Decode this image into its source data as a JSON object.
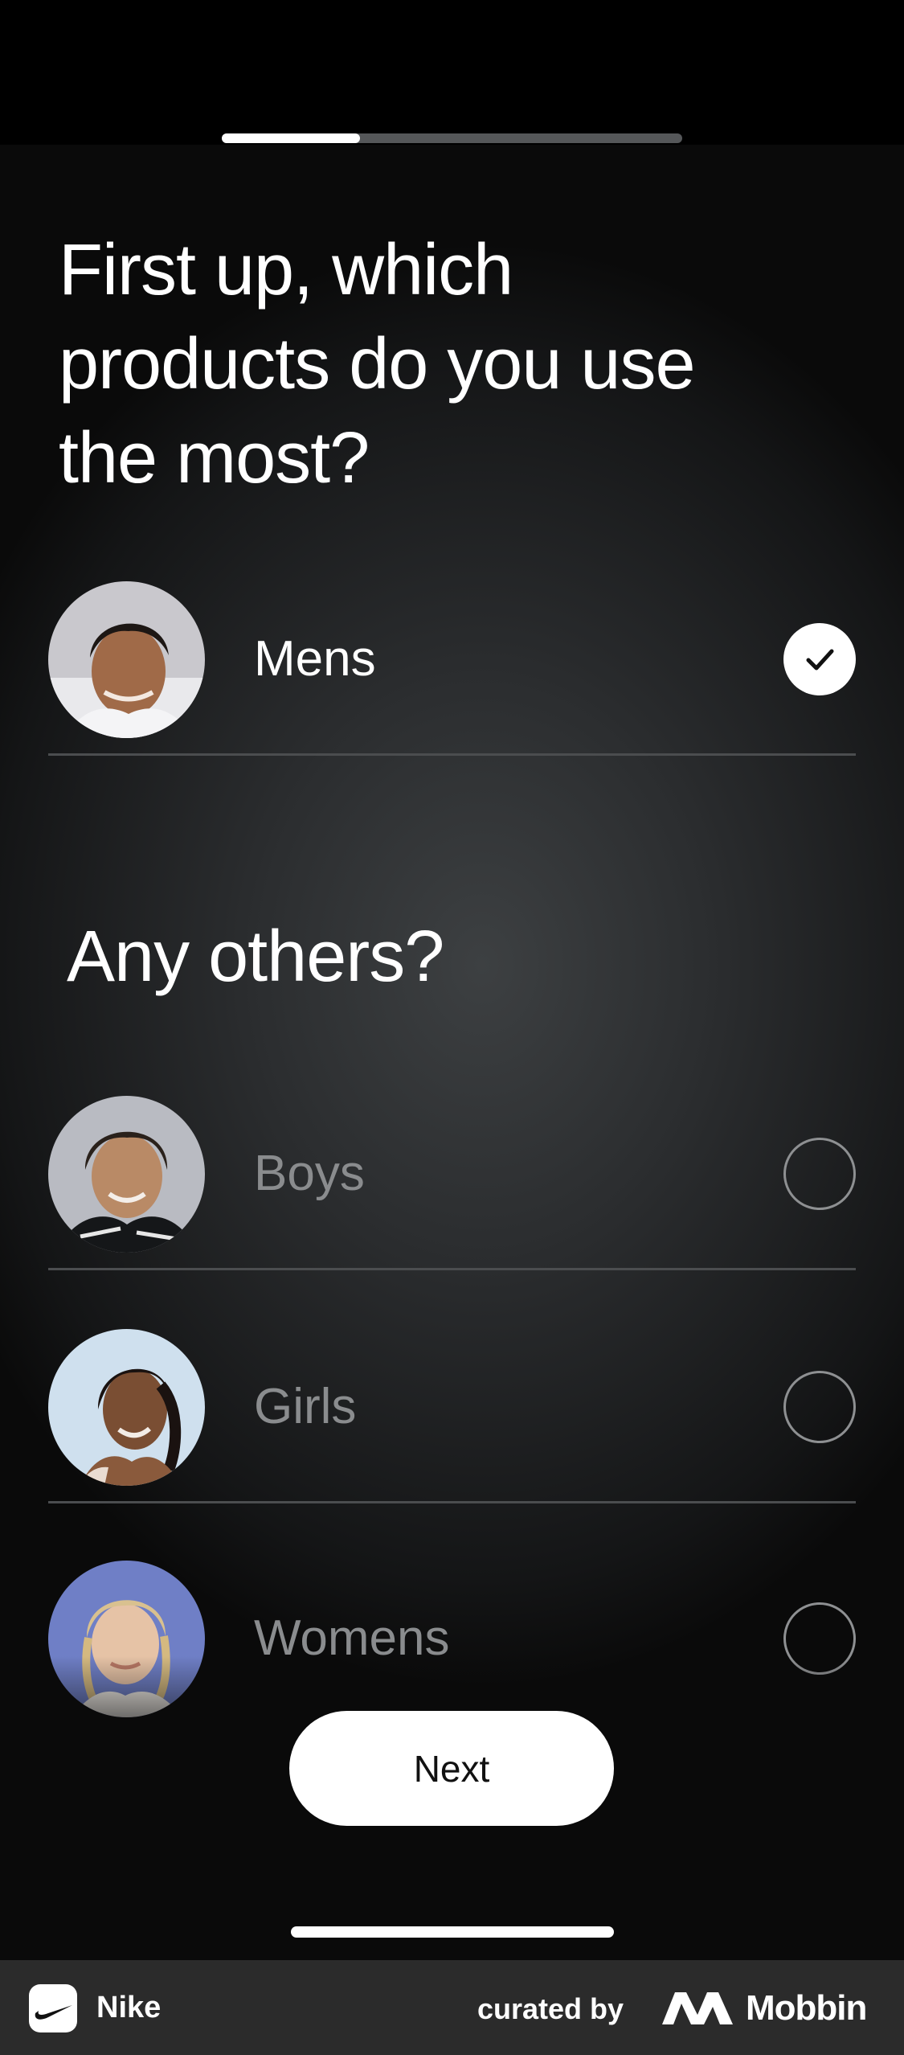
{
  "onboarding": {
    "progress_fraction": 0.3,
    "question": "First up, which\nproducts do you use\nthe most?",
    "primary_option": {
      "label": "Mens",
      "selected": true,
      "avatar": "mens-avatar"
    },
    "secondary_title": "Any others?",
    "secondary_options": [
      {
        "label": "Boys",
        "selected": false,
        "avatar": "boys-avatar"
      },
      {
        "label": "Girls",
        "selected": false,
        "avatar": "girls-avatar"
      },
      {
        "label": "Womens",
        "selected": false,
        "avatar": "womens-avatar"
      }
    ],
    "next_label": "Next"
  },
  "footer": {
    "app_name": "Nike",
    "app_icon": "nike-swoosh-icon",
    "curated_label": "curated by",
    "brand_name": "Mobbin",
    "brand_logo": "mobbin-logo-icon"
  },
  "colors": {
    "selected_check_bg": "#ffffff",
    "unselected_label": "#8a8c8e",
    "divider": "#4b4d4f",
    "progress_track": "#555759",
    "footer_bg": "#2b2b2b"
  }
}
